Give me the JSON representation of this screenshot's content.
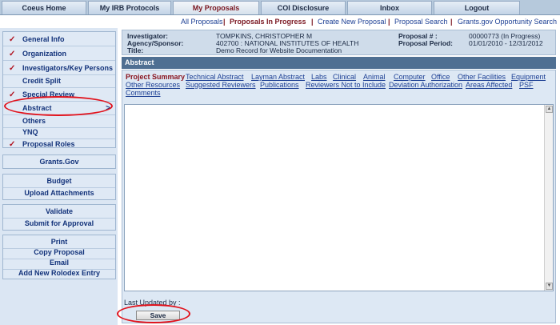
{
  "top_tabs": [
    "Coeus Home",
    "My IRB Protocols",
    "My Proposals",
    "COI Disclosure",
    "Inbox",
    "Logout"
  ],
  "active_top_tab": "My Proposals",
  "sub_nav": [
    "All Proposals",
    "Proposals In Progress",
    "Create New Proposal",
    "Proposal Search",
    "Grants.gov Opportunity Search"
  ],
  "active_sub_nav": "Proposals In Progress",
  "sidebar": {
    "group1": [
      {
        "label": "General Info",
        "checked": true
      },
      {
        "label": "Organization",
        "checked": true
      },
      {
        "label": "Investigators/Key Persons",
        "checked": true
      },
      {
        "label": "Credit Split",
        "checked": false
      },
      {
        "label": "Special Review",
        "checked": true
      },
      {
        "label": "Abstract",
        "checked": false,
        "selected": true,
        "arrow": ">"
      },
      {
        "label": "Others",
        "checked": false
      },
      {
        "label": "YNQ",
        "checked": false
      },
      {
        "label": "Proposal Roles",
        "checked": true
      }
    ],
    "group2": [
      "Grants.Gov"
    ],
    "group3": [
      "Budget",
      "Upload Attachments"
    ],
    "group4": [
      "Validate",
      "Submit for Approval"
    ],
    "group5": [
      "Print",
      "Copy Proposal",
      "Email",
      "Add New Rolodex Entry"
    ],
    "check_mark": "✓"
  },
  "info": {
    "investigator_label": "Investigator:",
    "investigator": "TOMPKINS, CHRISTOPHER M",
    "agency_label": "Agency/Sponsor:",
    "agency": "402700 : NATIONAL INSTITUTES OF HEALTH",
    "title_label": "Title:",
    "title": "Demo Record for Website Documentation",
    "proposal_no_label": "Proposal # :",
    "proposal_no": "00000773 (In Progress)",
    "period_label": "Proposal Period:",
    "period": "01/01/2010 - 12/31/2012"
  },
  "section_title": "Abstract",
  "abstract_links": {
    "row1": [
      "Project Summary",
      "Technical Abstract",
      "Layman Abstract",
      "Labs",
      "Clinical",
      "Animal",
      "Computer",
      "Office",
      "Other Facilities",
      "Equipment"
    ],
    "row2": [
      "Other Resources",
      "Suggested Reviewers",
      "Publications",
      "Reviewers Not to Include",
      "Deviation Authorization",
      "Areas Affected",
      "PSF"
    ],
    "row3": [
      "Comments"
    ],
    "active": "Project Summary"
  },
  "textarea_value": "",
  "last_updated_label": "Last Updated by :",
  "save_label": "Save",
  "colors": {
    "highlight": "#e1121c",
    "check": "#b0121f",
    "header_bar": "#4f6f92"
  }
}
